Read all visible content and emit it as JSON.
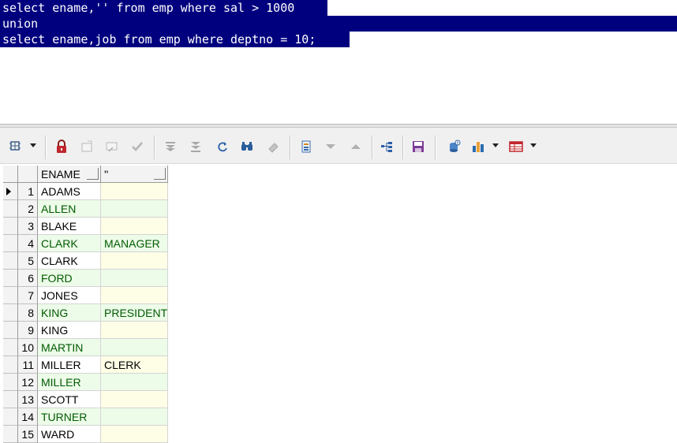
{
  "editor": {
    "lines": [
      "select ename,'' from emp where sal > 1000",
      "union",
      "select ename,job from emp where deptno = 10;"
    ]
  },
  "grid": {
    "columns": [
      "ENAME",
      "''"
    ],
    "rows": [
      {
        "n": "1",
        "ename": "ADAMS",
        "col2": ""
      },
      {
        "n": "2",
        "ename": "ALLEN",
        "col2": ""
      },
      {
        "n": "3",
        "ename": "BLAKE",
        "col2": ""
      },
      {
        "n": "4",
        "ename": "CLARK",
        "col2": "MANAGER"
      },
      {
        "n": "5",
        "ename": "CLARK",
        "col2": ""
      },
      {
        "n": "6",
        "ename": "FORD",
        "col2": ""
      },
      {
        "n": "7",
        "ename": "JONES",
        "col2": ""
      },
      {
        "n": "8",
        "ename": "KING",
        "col2": "PRESIDENT"
      },
      {
        "n": "9",
        "ename": "KING",
        "col2": ""
      },
      {
        "n": "10",
        "ename": "MARTIN",
        "col2": ""
      },
      {
        "n": "11",
        "ename": "MILLER",
        "col2": "CLERK"
      },
      {
        "n": "12",
        "ename": "MILLER",
        "col2": ""
      },
      {
        "n": "13",
        "ename": "SCOTT",
        "col2": ""
      },
      {
        "n": "14",
        "ename": "TURNER",
        "col2": ""
      },
      {
        "n": "15",
        "ename": "WARD",
        "col2": ""
      }
    ]
  },
  "toolbar": {
    "icons": [
      "grid-options-icon",
      "lock-icon",
      "add-record-icon",
      "delete-record-icon",
      "post-changes-icon",
      "fetch-next-page-icon",
      "fetch-last-page-icon",
      "refresh-query-icon",
      "find-icon",
      "clear-icon",
      "record-view-icon",
      "next-record-icon",
      "previous-record-icon",
      "query-by-example-icon",
      "save-icon",
      "export-data-icon",
      "chart-icon",
      "table-view-icon"
    ]
  },
  "colors": {
    "selection": "#00007f",
    "row_even": "#edfbe9",
    "col_empty": "#fefee6"
  }
}
